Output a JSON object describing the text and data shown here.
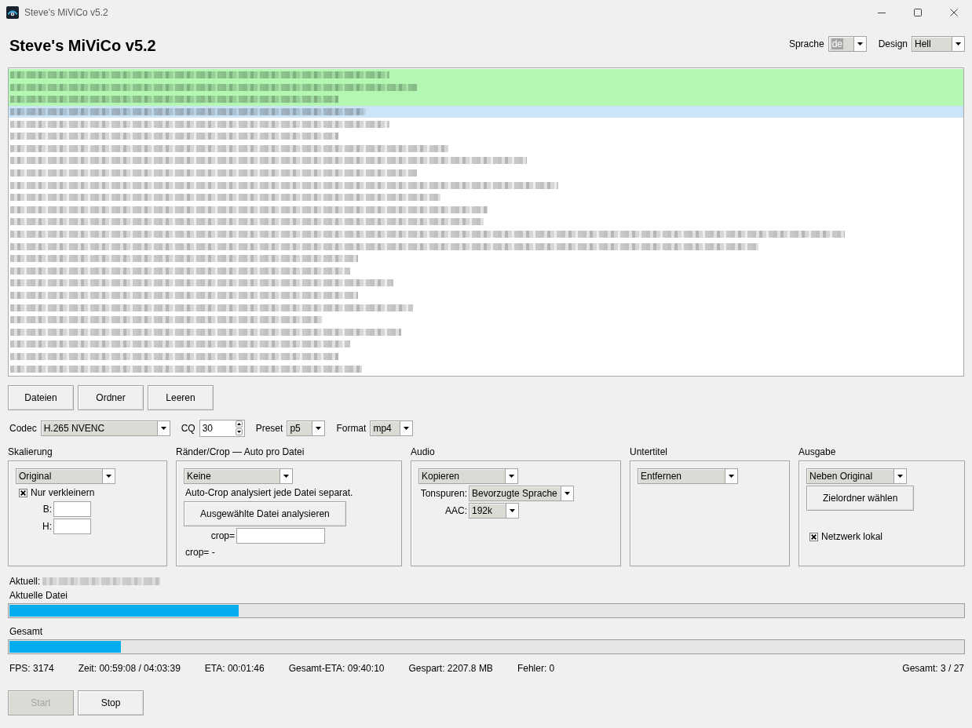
{
  "window": {
    "title": "Steve's MiViCo v5.2"
  },
  "header": {
    "title": "Steve's MiViCo v5.2",
    "selectors": [
      {
        "label": "Sprache",
        "value": "de",
        "focused": true
      },
      {
        "label": "Design",
        "value": "Hell",
        "focused": false
      }
    ]
  },
  "file_list": {
    "rows": [
      {
        "done": true,
        "selected": false
      },
      {
        "done": true,
        "selected": false
      },
      {
        "done": true,
        "selected": false
      },
      {
        "done": false,
        "selected": true
      },
      {
        "done": false,
        "selected": false
      },
      {
        "done": false,
        "selected": false
      },
      {
        "done": false,
        "selected": false
      },
      {
        "done": false,
        "selected": false
      },
      {
        "done": false,
        "selected": false
      },
      {
        "done": false,
        "selected": false
      },
      {
        "done": false,
        "selected": false
      },
      {
        "done": false,
        "selected": false
      },
      {
        "done": false,
        "selected": false
      },
      {
        "done": false,
        "selected": false
      },
      {
        "done": false,
        "selected": false
      },
      {
        "done": false,
        "selected": false
      },
      {
        "done": false,
        "selected": false
      },
      {
        "done": false,
        "selected": false
      },
      {
        "done": false,
        "selected": false
      },
      {
        "done": false,
        "selected": false
      },
      {
        "done": false,
        "selected": false
      },
      {
        "done": false,
        "selected": false
      },
      {
        "done": false,
        "selected": false
      },
      {
        "done": false,
        "selected": false
      },
      {
        "done": false,
        "selected": false
      }
    ]
  },
  "list_buttons": [
    "Dateien",
    "Ordner",
    "Leeren"
  ],
  "settings": [
    {
      "kind": "dropdown",
      "label": "Codec",
      "value": "H.265 NVENC"
    },
    {
      "kind": "spinbox",
      "label": "CQ",
      "value": "30"
    },
    {
      "kind": "dropdown",
      "label": "Preset",
      "value": "p5"
    },
    {
      "kind": "dropdown",
      "label": "Format",
      "value": "mp4"
    }
  ],
  "panels": [
    {
      "title": "Skalierung",
      "controls": [
        {
          "kind": "dropdown",
          "value": "Original"
        },
        {
          "kind": "checkbox",
          "label": "Nur verkleinern",
          "checked": true
        },
        {
          "kind": "field",
          "label": "B:"
        },
        {
          "kind": "field",
          "label": "H:"
        }
      ]
    },
    {
      "title": "Ränder/Crop — Auto pro Datei",
      "controls": [
        {
          "kind": "dropdown",
          "value": "Keine"
        },
        {
          "kind": "text",
          "text": "Auto-Crop analysiert jede Datei separat."
        },
        {
          "kind": "button",
          "label": "Ausgewählte Datei analysieren"
        },
        {
          "kind": "field",
          "label": "crop="
        },
        {
          "kind": "text",
          "text": "crop= -"
        }
      ]
    },
    {
      "title": "Audio",
      "controls": [
        {
          "kind": "dropdown",
          "value": "Kopieren"
        },
        {
          "kind": "dropdown",
          "label": "Tonspuren:",
          "value": "Bevorzugte Sprache"
        },
        {
          "kind": "dropdown",
          "label": "AAC:",
          "value": "192k"
        }
      ]
    },
    {
      "title": "Untertitel",
      "controls": [
        {
          "kind": "dropdown",
          "value": "Entfernen"
        }
      ]
    },
    {
      "title": "Ausgabe",
      "controls": [
        {
          "kind": "dropdown",
          "value": "Neben Original"
        },
        {
          "kind": "button",
          "label": "Zielordner wählen"
        },
        {
          "kind": "checkbox",
          "label": "Netzwerk lokal",
          "checked": true
        }
      ]
    }
  ],
  "current_file": {
    "label": "Aktuell:",
    "filename_blurred": true
  },
  "progress": [
    {
      "label": "Aktuelle Datei",
      "level": 0.24
    },
    {
      "label": "Gesamt",
      "level": 0.117
    }
  ],
  "stats": [
    "FPS: 3174",
    "Zeit: 00:59:08 / 04:03:39",
    "ETA: 00:01:46",
    "Gesamt-ETA: 09:40:10",
    "Gespart: 2207.8 MB",
    "Fehler: 0"
  ],
  "total": "Gesamt: 3 / 27",
  "actions": [
    {
      "label": "Start",
      "disabled": true
    },
    {
      "label": "Stop",
      "disabled": false
    }
  ]
}
